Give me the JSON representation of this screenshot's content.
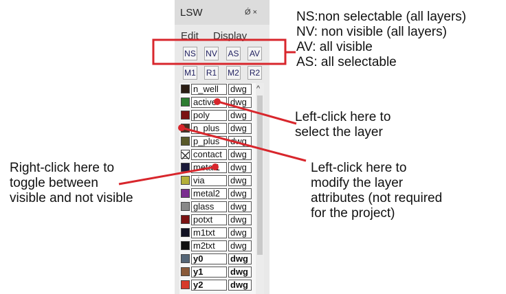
{
  "window": {
    "title": "LSW",
    "controls": "Ǿ ×"
  },
  "menu": [
    "Edit",
    "Display"
  ],
  "buttons_row1": [
    "NS",
    "NV",
    "AS",
    "AV"
  ],
  "buttons_row2": [
    "M1",
    "R1",
    "M2",
    "R2"
  ],
  "layers": [
    {
      "name": "n_well",
      "purpose": "dwg",
      "color": "#2b1d14",
      "bold": false
    },
    {
      "name": "active",
      "purpose": "dwg",
      "color": "#2e7d32",
      "bold": false
    },
    {
      "name": "poly",
      "purpose": "dwg",
      "color": "#7a1212",
      "bold": false
    },
    {
      "name": "n_plus",
      "purpose": "dwg",
      "color": "#4a2f20",
      "bold": false
    },
    {
      "name": "p_plus",
      "purpose": "dwg",
      "color": "#5a5a2a",
      "bold": false
    },
    {
      "name": "contact",
      "purpose": "dwg",
      "color": "#ffffff",
      "bold": false
    },
    {
      "name": "metal1",
      "purpose": "dwg",
      "color": "#1a1a3a",
      "bold": false
    },
    {
      "name": "via",
      "purpose": "dwg",
      "color": "#b5b03a",
      "bold": false
    },
    {
      "name": "metal2",
      "purpose": "dwg",
      "color": "#7a2d8f",
      "bold": false
    },
    {
      "name": "glass",
      "purpose": "dwg",
      "color": "#888888",
      "bold": false
    },
    {
      "name": "potxt",
      "purpose": "dwg",
      "color": "#7a1212",
      "bold": false
    },
    {
      "name": "m1txt",
      "purpose": "dwg",
      "color": "#111122",
      "bold": false
    },
    {
      "name": "m2txt",
      "purpose": "dwg",
      "color": "#111111",
      "bold": false
    },
    {
      "name": "y0",
      "purpose": "dwg",
      "color": "#556677",
      "bold": true
    },
    {
      "name": "y1",
      "purpose": "dwg",
      "color": "#8a5a3a",
      "bold": true
    },
    {
      "name": "y2",
      "purpose": "dwg",
      "color": "#d63a2a",
      "bold": true
    }
  ],
  "annotations": {
    "legend": [
      "NS:non selectable (all layers)",
      "NV: non visible (all layers)",
      "AV: all visible",
      "AS: all selectable"
    ],
    "select_layer": [
      "Left-click here to",
      "select the layer"
    ],
    "toggle_visibility": [
      "Right-click here to",
      "toggle between",
      "visible and not visible"
    ],
    "modify_attributes": [
      "Left-click here to",
      "modify the layer",
      "attributes (not required",
      "for the project)"
    ]
  },
  "colors": {
    "annotation_red": "#d8262c",
    "scroll_arrow": "^"
  }
}
